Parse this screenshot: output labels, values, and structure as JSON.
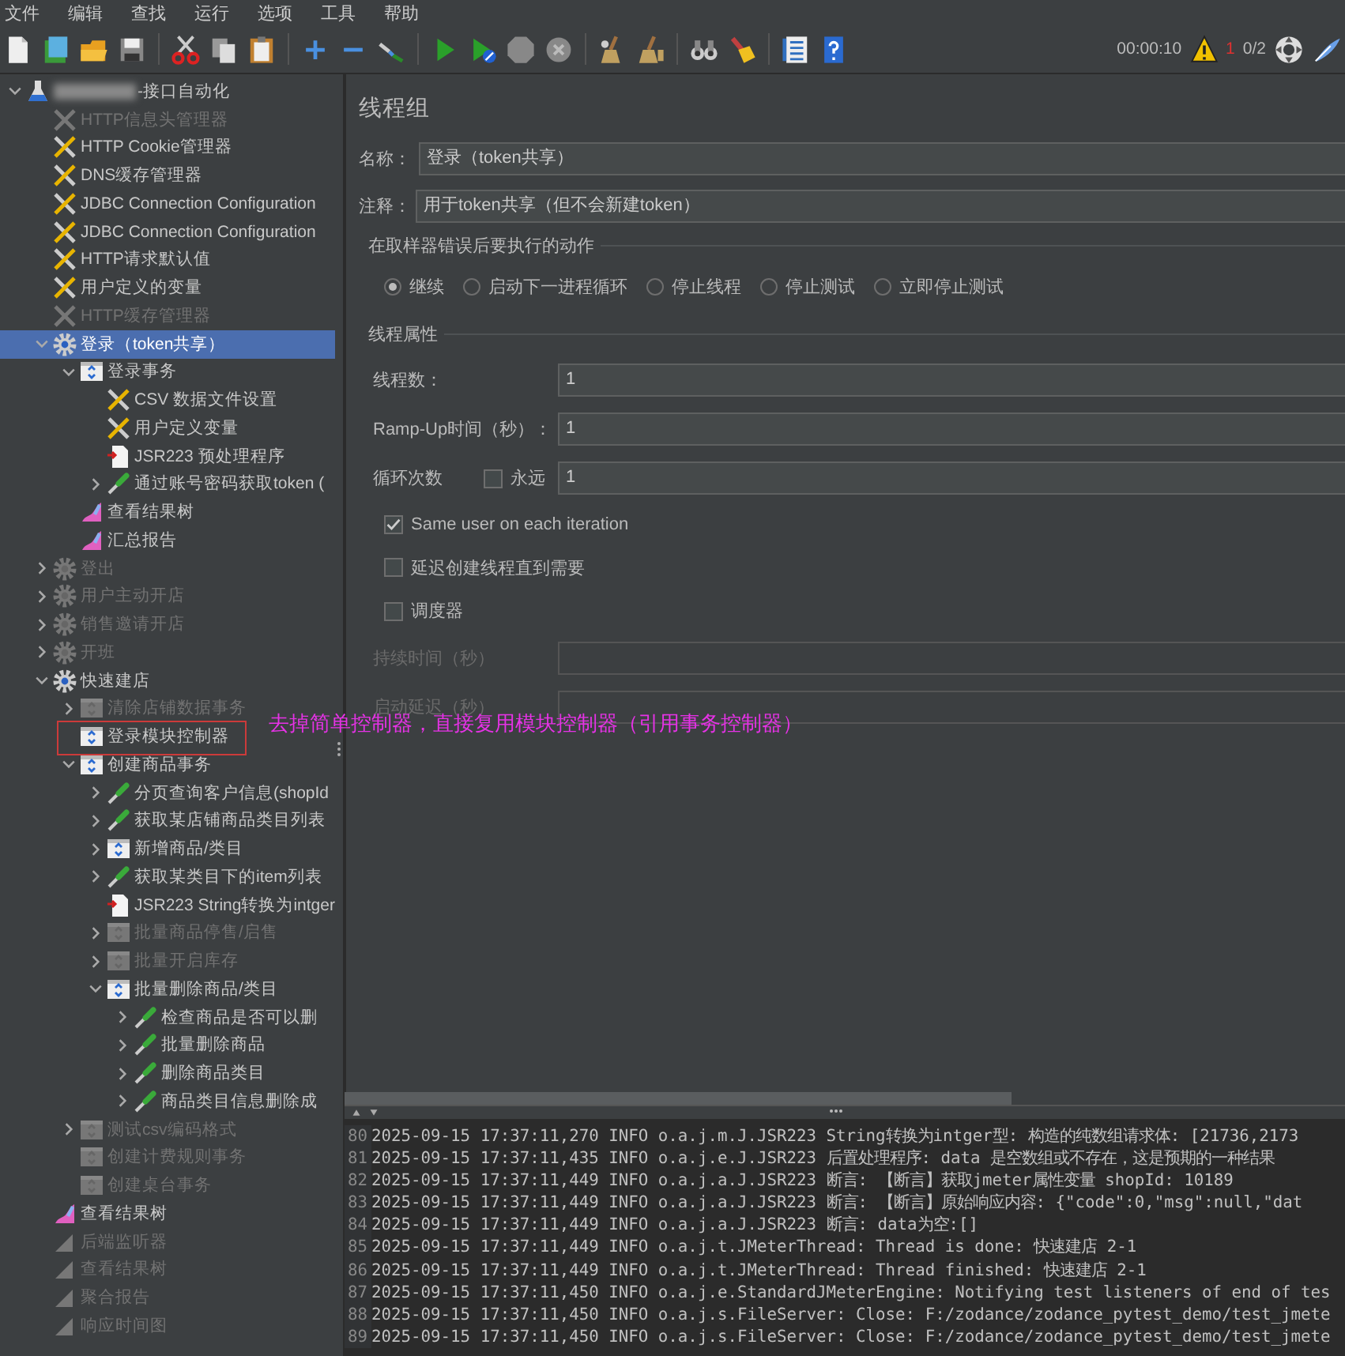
{
  "menu": [
    "文件",
    "编辑",
    "查找",
    "运行",
    "选项",
    "工具",
    "帮助"
  ],
  "toolbar": {
    "timer": "00:00:10",
    "error_count": "1",
    "active_threads": "0/2"
  },
  "tree": {
    "label": "-接口自动化",
    "kind": "plan",
    "redacted_prefix": true,
    "expanded": true,
    "selected": false,
    "disabled": false,
    "children": [
      {
        "label": "HTTP信息头管理器",
        "kind": "config",
        "selected": false,
        "disabled": true
      },
      {
        "label": "HTTP Cookie管理器",
        "kind": "config",
        "selected": false,
        "disabled": false
      },
      {
        "label": "DNS缓存管理器",
        "kind": "config",
        "selected": false,
        "disabled": false
      },
      {
        "label": "JDBC Connection Configuration",
        "kind": "config",
        "selected": false,
        "disabled": false
      },
      {
        "label": "JDBC Connection Configuration",
        "kind": "config",
        "selected": false,
        "disabled": false
      },
      {
        "label": "HTTP请求默认值",
        "kind": "config",
        "selected": false,
        "disabled": false
      },
      {
        "label": "用户定义的变量",
        "kind": "config",
        "selected": false,
        "disabled": false
      },
      {
        "label": "HTTP缓存管理器",
        "kind": "config",
        "selected": false,
        "disabled": true
      },
      {
        "label": "登录（token共享）",
        "kind": "thread_group",
        "expanded": true,
        "selected": true,
        "disabled": false,
        "children": [
          {
            "label": "登录事务",
            "kind": "transaction",
            "expanded": true,
            "selected": false,
            "disabled": false,
            "children": [
              {
                "label": "CSV 数据文件设置",
                "kind": "config",
                "selected": false,
                "disabled": false
              },
              {
                "label": "用户定义变量",
                "kind": "config",
                "selected": false,
                "disabled": false
              },
              {
                "label": "JSR223 预处理程序",
                "kind": "script",
                "selected": false,
                "disabled": false
              },
              {
                "label": "通过账号密码获取token (",
                "kind": "sampler",
                "expanded": false,
                "selected": false,
                "disabled": false
              }
            ]
          },
          {
            "label": "查看结果树",
            "kind": "listener",
            "selected": false,
            "disabled": false
          },
          {
            "label": "汇总报告",
            "kind": "listener",
            "selected": false,
            "disabled": false
          }
        ]
      },
      {
        "label": "登出",
        "kind": "thread_group",
        "expanded": false,
        "selected": false,
        "disabled": true
      },
      {
        "label": "用户主动开店",
        "kind": "thread_group",
        "expanded": false,
        "selected": false,
        "disabled": true
      },
      {
        "label": "销售邀请开店",
        "kind": "thread_group",
        "expanded": false,
        "selected": false,
        "disabled": true
      },
      {
        "label": "开班",
        "kind": "thread_group",
        "expanded": false,
        "selected": false,
        "disabled": true
      },
      {
        "label": "快速建店",
        "kind": "thread_group",
        "expanded": true,
        "selected": false,
        "disabled": false,
        "children": [
          {
            "label": "清除店铺数据事务",
            "kind": "transaction",
            "expanded": false,
            "selected": false,
            "disabled": true
          },
          {
            "label": "登录模块控制器",
            "kind": "transaction",
            "selected": false,
            "disabled": false
          },
          {
            "label": "创建商品事务",
            "kind": "transaction",
            "expanded": true,
            "selected": false,
            "disabled": false,
            "children": [
              {
                "label": "分页查询客户信息(shopId",
                "kind": "sampler",
                "expanded": false,
                "selected": false,
                "disabled": false
              },
              {
                "label": "获取某店铺商品类目列表",
                "kind": "sampler",
                "expanded": false,
                "selected": false,
                "disabled": false
              },
              {
                "label": "新增商品/类目",
                "kind": "transaction",
                "expanded": false,
                "selected": false,
                "disabled": false
              },
              {
                "label": "获取某类目下的item列表",
                "kind": "sampler",
                "expanded": false,
                "selected": false,
                "disabled": false
              },
              {
                "label": "JSR223 String转换为intger",
                "kind": "script",
                "selected": false,
                "disabled": false
              },
              {
                "label": "批量商品停售/启售",
                "kind": "transaction",
                "expanded": false,
                "selected": false,
                "disabled": true
              },
              {
                "label": "批量开启库存",
                "kind": "transaction",
                "expanded": false,
                "selected": false,
                "disabled": true
              },
              {
                "label": "批量删除商品/类目",
                "kind": "transaction",
                "expanded": true,
                "selected": false,
                "disabled": false,
                "children": [
                  {
                    "label": "检查商品是否可以删",
                    "kind": "sampler",
                    "expanded": false,
                    "selected": false,
                    "disabled": false
                  },
                  {
                    "label": "批量删除商品",
                    "kind": "sampler",
                    "expanded": false,
                    "selected": false,
                    "disabled": false
                  },
                  {
                    "label": "删除商品类目",
                    "kind": "sampler",
                    "expanded": false,
                    "selected": false,
                    "disabled": false
                  },
                  {
                    "label": "商品类目信息删除成",
                    "kind": "sampler",
                    "expanded": false,
                    "selected": false,
                    "disabled": false
                  }
                ]
              }
            ]
          },
          {
            "label": "测试csv编码格式",
            "kind": "transaction",
            "expanded": false,
            "selected": false,
            "disabled": true
          },
          {
            "label": "创建计费规则事务",
            "kind": "transaction",
            "selected": false,
            "disabled": true
          },
          {
            "label": "创建桌台事务",
            "kind": "transaction",
            "selected": false,
            "disabled": true
          }
        ]
      },
      {
        "label": "查看结果树",
        "kind": "listener",
        "selected": false,
        "disabled": false
      },
      {
        "label": "后端监听器",
        "kind": "listener",
        "selected": false,
        "disabled": true
      },
      {
        "label": "查看结果树",
        "kind": "listener",
        "selected": false,
        "disabled": true
      },
      {
        "label": "聚合报告",
        "kind": "listener",
        "selected": false,
        "disabled": true
      },
      {
        "label": "响应时间图",
        "kind": "listener",
        "selected": false,
        "disabled": true
      }
    ]
  },
  "panel": {
    "title": "线程组",
    "name": {
      "label": "名称：",
      "value": "登录（token共享）"
    },
    "comment": {
      "label": "注释：",
      "value": "用于token共享（但不会新建token）"
    },
    "error_action": {
      "title": "在取样器错误后要执行的动作",
      "options": [
        {
          "label": "继续",
          "selected": true
        },
        {
          "label": "启动下一进程循环",
          "selected": false
        },
        {
          "label": "停止线程",
          "selected": false
        },
        {
          "label": "停止测试",
          "selected": false
        },
        {
          "label": "立即停止测试",
          "selected": false
        }
      ]
    },
    "thread_properties": {
      "title": "线程属性",
      "fields": [
        {
          "kind": "field",
          "label": "线程数：",
          "value": "1"
        },
        {
          "kind": "field",
          "label": "Ramp-Up时间（秒）：",
          "value": "1"
        },
        {
          "kind": "loop",
          "label": "循环次数",
          "value": "1",
          "forever_label": "永远",
          "forever_checked": false
        }
      ],
      "options": [
        {
          "label": "Same user on each iteration",
          "checked": true
        },
        {
          "label": "延迟创建线程直到需要",
          "checked": false
        },
        {
          "label": "调度器",
          "checked": false
        }
      ],
      "schedule_fields": [
        {
          "label": "持续时间（秒）",
          "disabled": true
        },
        {
          "label": "启动延迟（秒）",
          "disabled": true
        }
      ]
    }
  },
  "log": {
    "lines": [
      {
        "number": "80",
        "text": "2025-09-15 17:37:11,270 INFO o.a.j.m.J.JSR223 String转换为intger型: 构造的纯数组请求体: [21736,2173"
      },
      {
        "number": "81",
        "text": "2025-09-15 17:37:11,435 INFO o.a.j.e.J.JSR223 后置处理程序: data 是空数组或不存在，这是预期的一种结果"
      },
      {
        "number": "82",
        "text": "2025-09-15 17:37:11,449 INFO o.a.j.a.J.JSR223 断言: 【断言】获取jmeter属性变量 shopId: 10189"
      },
      {
        "number": "83",
        "text": "2025-09-15 17:37:11,449 INFO o.a.j.a.J.JSR223 断言: 【断言】原始响应内容: {\"code\":0,\"msg\":null,\"dat"
      },
      {
        "number": "84",
        "text": "2025-09-15 17:37:11,449 INFO o.a.j.a.J.JSR223 断言: data为空:[]"
      },
      {
        "number": "85",
        "text": "2025-09-15 17:37:11,449 INFO o.a.j.t.JMeterThread: Thread is done: 快速建店 2-1"
      },
      {
        "number": "86",
        "text": "2025-09-15 17:37:11,449 INFO o.a.j.t.JMeterThread: Thread finished: 快速建店 2-1"
      },
      {
        "number": "87",
        "text": "2025-09-15 17:37:11,450 INFO o.a.j.e.StandardJMeterEngine: Notifying test listeners of end of tes"
      },
      {
        "number": "88",
        "text": "2025-09-15 17:37:11,450 INFO o.a.j.s.FileServer: Close: F:/zodance/zodance_pytest_demo/test_jmete"
      },
      {
        "number": "89",
        "text": "2025-09-15 17:37:11,450 INFO o.a.j.s.FileServer: Close: F:/zodance/zodance_pytest_demo/test_jmete"
      }
    ]
  },
  "annotation": {
    "text": "去掉简单控制器，直接复用模块控制器（引用事务控制器）"
  }
}
